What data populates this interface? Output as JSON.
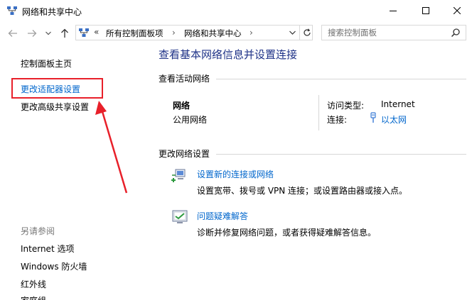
{
  "window": {
    "title": "网络和共享中心"
  },
  "address": {
    "chevron": "«",
    "segment1": "所有控制面板项",
    "separator": "›",
    "segment2": "网络和共享中心",
    "search_placeholder": "搜索控制面板"
  },
  "sidebar": {
    "home": "控制面板主页",
    "adapter": "更改适配器设置",
    "advanced": "更改高级共享设置",
    "see_also": "另请参阅",
    "see_also_items": [
      "Internet 选项",
      "Windows 防火墙",
      "红外线",
      "家庭组"
    ]
  },
  "main": {
    "title": "查看基本网络信息并设置连接",
    "active_section": "查看活动网络",
    "network_name": "网络",
    "network_type": "公用网络",
    "access_type_label": "访问类型:",
    "access_type_value": "Internet",
    "connection_label": "连接:",
    "connection_value": "以太网",
    "change_section": "更改网络设置",
    "tasks": [
      {
        "link": "设置新的连接或网络",
        "desc": "设置宽带、拨号或 VPN 连接；或设置路由器或接入点。"
      },
      {
        "link": "问题疑难解答",
        "desc": "诊断并修复网络问题，或者获得疑难解答信息。"
      }
    ]
  },
  "colors": {
    "link": "#0066cc",
    "title": "#1e3287",
    "annotation": "#e8202a"
  }
}
